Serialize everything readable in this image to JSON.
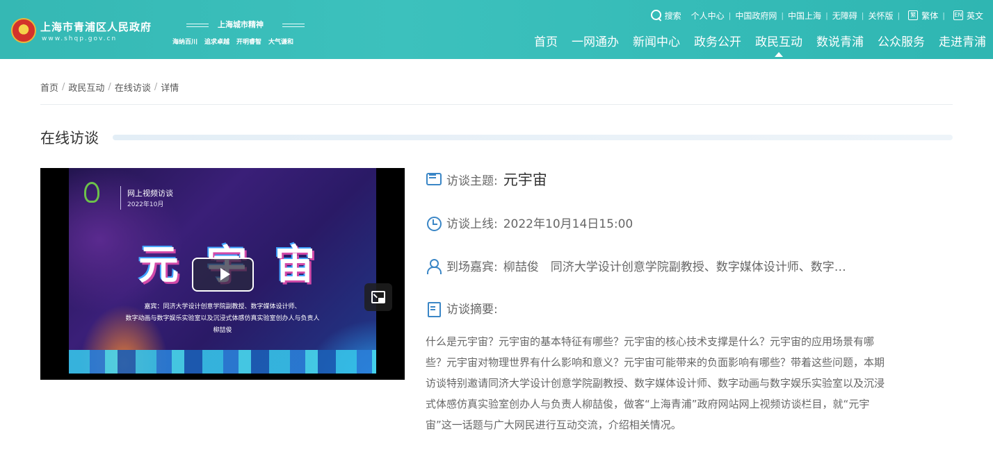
{
  "header": {
    "site_name": "上海市青浦区人民政府",
    "site_url": "www.shqp.gov.cn",
    "spirit_title": "上海城市精神",
    "spirit_words": [
      "海纳百川",
      "追求卓越",
      "开明睿智",
      "大气谦和"
    ],
    "topbar": {
      "search": "搜索",
      "links": [
        "个人中心",
        "中国政府网",
        "中国上海",
        "无障碍",
        "关怀版"
      ],
      "traditional_icon": "繁",
      "traditional": "繁体",
      "english_icon": "EN",
      "english": "英文"
    },
    "nav": [
      "首页",
      "一网通办",
      "新闻中心",
      "政务公开",
      "政民互动",
      "数说青浦",
      "公众服务",
      "走进青浦"
    ],
    "active_nav": "政民互动"
  },
  "breadcrumb": [
    "首页",
    "政民互动",
    "在线访谈",
    "详情"
  ],
  "section_title": "在线访谈",
  "video": {
    "poster_sub1": "网上视频访谈",
    "poster_sub2": "2022年10月",
    "poster_title": "元宇宙",
    "poster_guest_lines": [
      "嘉宾：同济大学设计创意学院副教授、数字媒体设计师、",
      "数字动画与数字娱乐实验室以及沉浸式体感仿真实验室创办人与负责人",
      "柳喆俊"
    ]
  },
  "info": {
    "topic_label": "访谈主题:",
    "topic_value": "元宇宙",
    "time_label": "访谈上线:",
    "time_value": "2022年10月14日15:00",
    "guest_label": "到场嘉宾:",
    "guest_value": "柳喆俊　同济大学设计创意学院副教授、数字媒体设计师、数字…",
    "summary_label": "访谈摘要:",
    "summary_text": "什么是元宇宙？元宇宙的基本特征有哪些？元宇宙的核心技术支撑是什么？元宇宙的应用场景有哪些？元宇宙对物理世界有什么影响和意义？元宇宙可能带来的负面影响有哪些？带着这些问题，本期访谈特别邀请同济大学设计创意学院副教授、数字媒体设计师、数字动画与数字娱乐实验室以及沉浸式体感仿真实验室创办人与负责人柳喆俊，做客“上海青浦”政府网站网上视频访谈栏目，就“元宇宙”这一话题与广大网民进行互动交流，介绍相关情况。"
  },
  "colors": {
    "header_bg": "#3cc1bd",
    "icon_accent": "#3a86c6",
    "page_bg": "#f1f4f7"
  }
}
